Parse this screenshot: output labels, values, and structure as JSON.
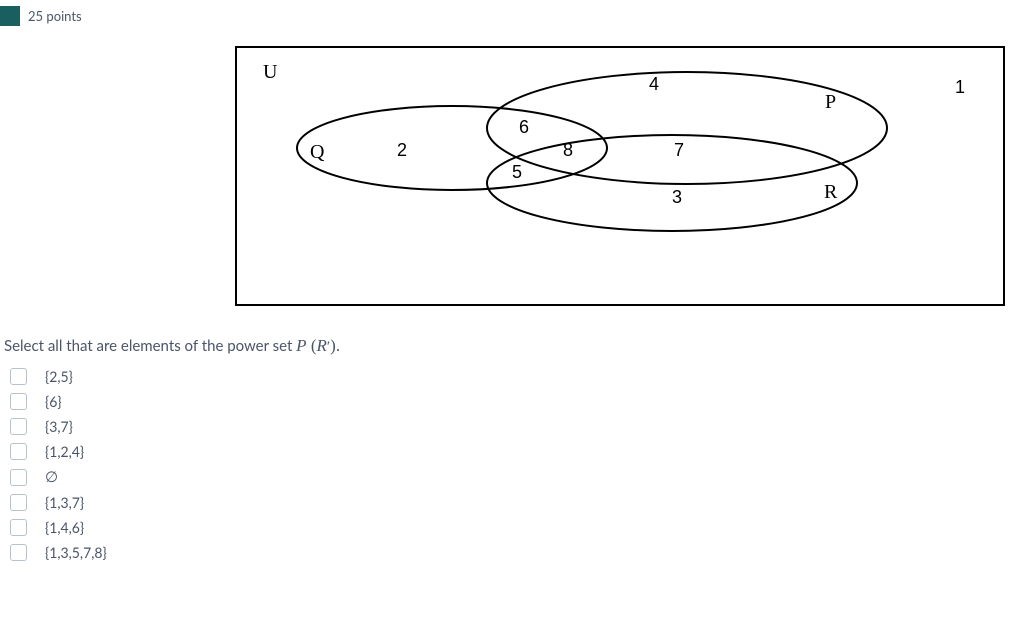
{
  "header": {
    "points": "25 points"
  },
  "diagram": {
    "universe_label": "U",
    "sets": {
      "Q": "Q",
      "P": "P",
      "R": "R"
    },
    "numbers": {
      "n1": "1",
      "n2": "2",
      "n3": "3",
      "n4": "4",
      "n5": "5",
      "n6": "6",
      "n7": "7",
      "n8": "8"
    }
  },
  "prompt": {
    "prefix": "Select all that are elements of the power set ",
    "math_P": "P",
    "math_open": " (",
    "math_R": "R",
    "math_prime": "′",
    "math_close": ").",
    "suffix": ""
  },
  "options": [
    {
      "label": "{2,5}"
    },
    {
      "label": "{6}"
    },
    {
      "label": "{3,7}"
    },
    {
      "label": "{1,2,4}"
    },
    {
      "label": "∅"
    },
    {
      "label": "{1,3,7}"
    },
    {
      "label": "{1,4,6}"
    },
    {
      "label": "{1,3,5,7,8}"
    }
  ]
}
